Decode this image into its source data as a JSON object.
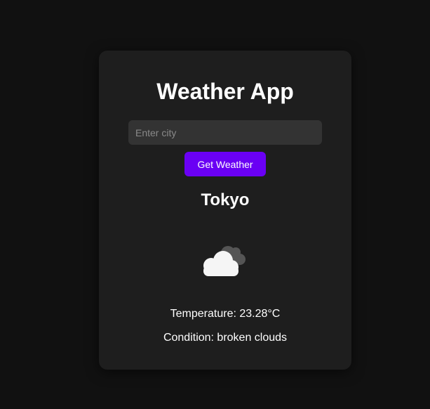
{
  "app": {
    "title": "Weather App"
  },
  "search": {
    "placeholder": "Enter city",
    "value": "",
    "button_label": "Get Weather"
  },
  "weather": {
    "city": "Tokyo",
    "icon": "broken-clouds-icon",
    "temperature_label": "Temperature: 23.28°C",
    "condition_label": "Condition: broken clouds"
  },
  "colors": {
    "page_bg": "#111111",
    "card_bg": "#1e1e1e",
    "input_bg": "#333333",
    "accent": "#6a00f4",
    "text": "#ffffff"
  }
}
